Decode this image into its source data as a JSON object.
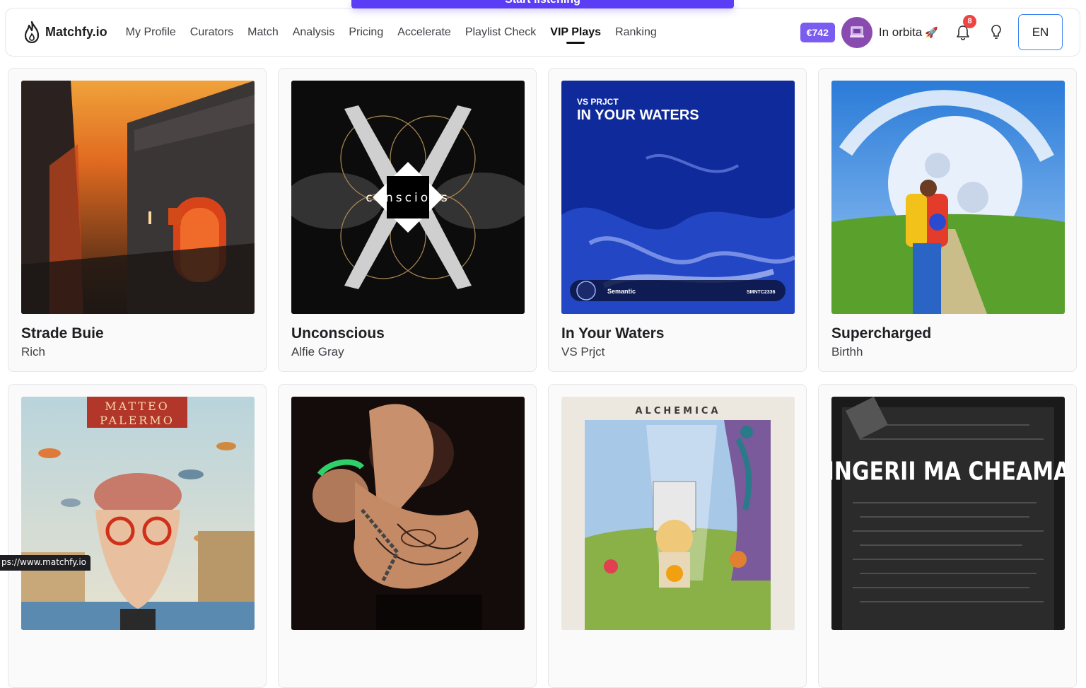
{
  "banner": {
    "label": "Start listening"
  },
  "brand": {
    "name": "Matchfy.io"
  },
  "nav": [
    {
      "label": "My Profile"
    },
    {
      "label": "Curators"
    },
    {
      "label": "Match"
    },
    {
      "label": "Analysis"
    },
    {
      "label": "Pricing"
    },
    {
      "label": "Accelerate"
    },
    {
      "label": "Playlist Check"
    },
    {
      "label": "VIP Plays",
      "active": true
    },
    {
      "label": "Ranking"
    }
  ],
  "header": {
    "balance": "€742",
    "status": "In orbita",
    "status_icon": "rocket-icon",
    "notifications": "8",
    "language": "EN"
  },
  "tracks": [
    {
      "title": "Strade Buie",
      "artist": "Rich"
    },
    {
      "title": "Unconscious",
      "artist": "Alfie Gray"
    },
    {
      "title": "In Your Waters",
      "artist": "VS Prjct"
    },
    {
      "title": "Supercharged",
      "artist": "Birthh"
    },
    {
      "title": "",
      "artist": ""
    },
    {
      "title": "",
      "artist": ""
    },
    {
      "title": "",
      "artist": ""
    },
    {
      "title": "",
      "artist": ""
    }
  ],
  "cover_text": {
    "c2": "conscious",
    "c3_artist": "VS PRJCT",
    "c3_title": "IN YOUR WATERS",
    "c3_label": "Semantic",
    "c3_code": "SMNTC2336",
    "c5_line1": "MATTEO",
    "c5_line2": "PALERMO",
    "c7": "ALCHEMICA",
    "c8": "INGERII MA CHEAMA"
  },
  "statusbar": {
    "url": "ps://www.matchfy.io"
  },
  "colors": {
    "accent": "#7b5cf0",
    "banner": "#5b3df5",
    "badge": "#ef4444",
    "lang_border": "#3b82f6"
  }
}
